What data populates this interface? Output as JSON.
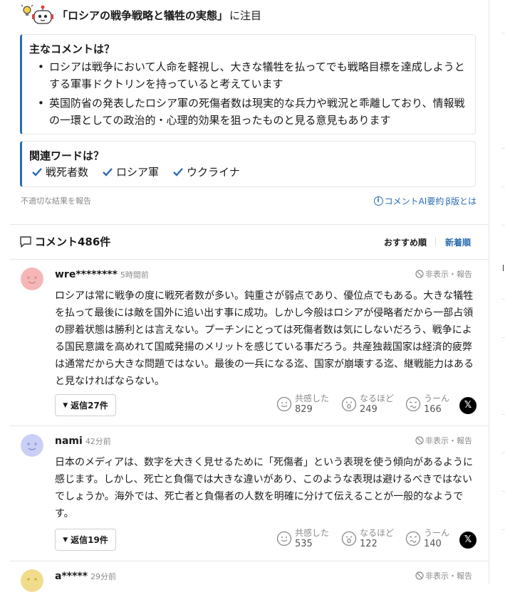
{
  "header": {
    "title": "「ロシアの戦争戦略と犠牲の実態」",
    "suffix": "に注目"
  },
  "summary": {
    "title": "主なコメントは？",
    "bullets": [
      "ロシアは戦争において人命を軽視し、大きな犠牲を払ってでも戦略目標を達成しようとする軍事ドクトリンを持っていると考えています",
      "英国防省の発表したロシア軍の死傷者数は現実的な兵力や戦況と乖離しており、情報戦の一環としての政治的・心理的効果を狙ったものと見る意見もあります"
    ]
  },
  "related": {
    "title": "関連ワードは？",
    "words": [
      "戦死者数",
      "ロシア軍",
      "ウクライナ"
    ]
  },
  "footer": {
    "report_link": "不適切な結果を報告",
    "ai_link": "コメントAI要約",
    "beta_link": "β版とは"
  },
  "comments_header": {
    "label": "コメント486件",
    "sort_recommended": "おすすめ順",
    "sort_newest": "新着順"
  },
  "colors": {
    "accent": "#2b6cb0",
    "avatar_pink": "#f4b6b6",
    "avatar_blue": "#c9cff5",
    "avatar_yellow": "#f1dc8c"
  },
  "comments": [
    {
      "user": "wre********",
      "time": "5時間前",
      "hide_label": "非表示・報告",
      "text": "ロシアは常に戦争の度に戦死者数が多い。鈍重さが弱点であり、優位点でもある。大きな犠牲を払って最後には敵を国外に追い出す事に成功。しかし今般はロシアが侵略者だから一部占領の膠着状態は勝利とは言えない。プーチンにとっては死傷者数は気にしないだろう、戦争による国民意識を高めれて国威発揚のメリットを感じている事だろう。共産独裁国家は経済的疲弊は通常だから大きな問題ではない。最後の一兵になる迄、国家が崩壊する迄、継戦能力はあると見なければならない。",
      "reply_label": "返信27件",
      "reactions": [
        {
          "label": "共感した",
          "count": "829",
          "icon": "smile-icon"
        },
        {
          "label": "なるほど",
          "count": "249",
          "icon": "surprised-icon"
        },
        {
          "label": "うーん",
          "count": "166",
          "icon": "confused-icon"
        }
      ],
      "share": "𝕏"
    },
    {
      "user": "nami",
      "time": "42分前",
      "hide_label": "非表示・報告",
      "text": "日本のメディアは、数字を大きく見せるために「死傷者」という表現を使う傾向があるように感じます。しかし、死亡と負傷では大きな違いがあり、このような表現は避けるべきではないでしょうか。海外では、死亡者と負傷者の人数を明確に分けて伝えることが一般的なようです。",
      "reply_label": "返信19件",
      "reactions": [
        {
          "label": "共感した",
          "count": "535",
          "icon": "smile-icon"
        },
        {
          "label": "なるほど",
          "count": "122",
          "icon": "surprised-icon"
        },
        {
          "label": "うーん",
          "count": "140",
          "icon": "confused-icon"
        }
      ],
      "share": "𝕏"
    },
    {
      "user": "a*****",
      "time": "29分前",
      "hide_label": "非表示・報告"
    }
  ]
}
